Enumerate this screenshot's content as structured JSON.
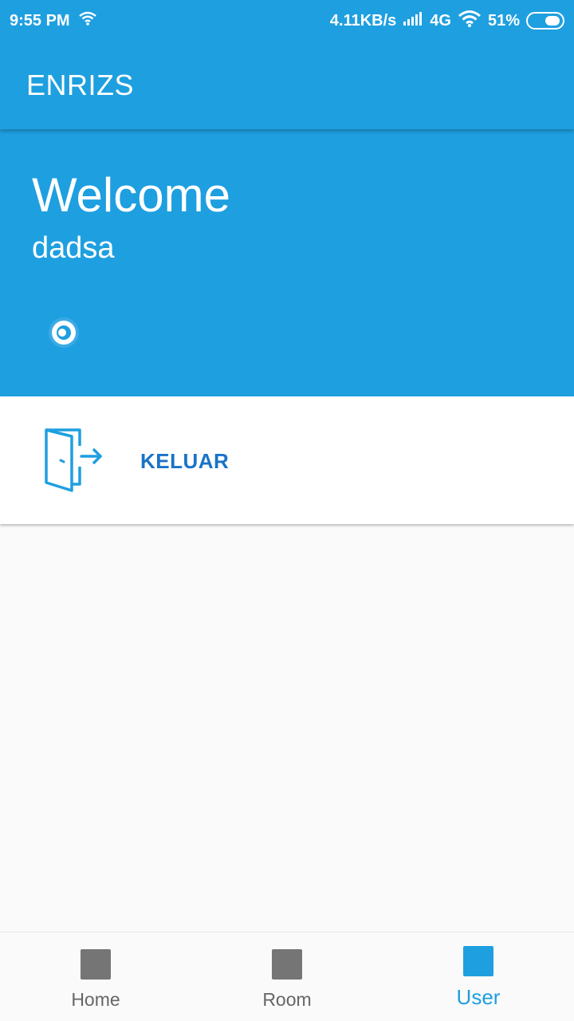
{
  "status_bar": {
    "time": "9:55 PM",
    "network_speed": "4.11KB/s",
    "network_type": "4G",
    "battery_percent": "51%",
    "battery_level": 0.51
  },
  "app_bar": {
    "title": "ENRIZS"
  },
  "welcome": {
    "title": "Welcome",
    "username": "dadsa"
  },
  "logout": {
    "label": "KELUAR",
    "icon": "door-exit-icon"
  },
  "bottom_nav": {
    "items": [
      {
        "label": "Home",
        "active": false
      },
      {
        "label": "Room",
        "active": false
      },
      {
        "label": "User",
        "active": true
      }
    ]
  },
  "colors": {
    "primary": "#1e9fe0",
    "accent_text": "#1a73c7",
    "inactive_nav": "#757575",
    "background": "#fafafa"
  }
}
